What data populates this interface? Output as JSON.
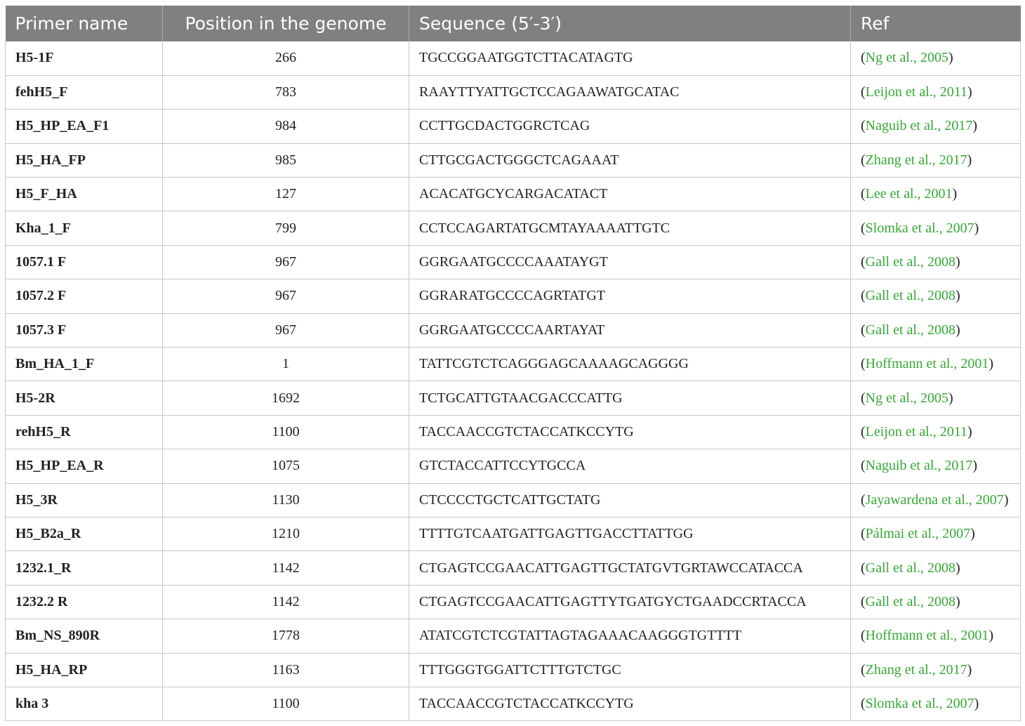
{
  "table": {
    "headers": {
      "primer_name": "Primer name",
      "position": "Position in the genome",
      "sequence": "Sequence (5′-3′)",
      "ref": "Ref"
    },
    "rows": [
      {
        "name": "H5-1F",
        "position": "266",
        "sequence": "TGCCGGAATGGTCTTACATAGTG",
        "ref": "Ng et al., 2005"
      },
      {
        "name": "fehH5_F",
        "position": "783",
        "sequence": "RAAYTTYATTGCTCCAGAAWATGCATAC",
        "ref": "Leijon et al., 2011"
      },
      {
        "name": "H5_HP_EA_F1",
        "position": "984",
        "sequence": "CCTTGCDACTGGRCTCAG",
        "ref": "Naguib et al., 2017"
      },
      {
        "name": "H5_HA_FP",
        "position": "985",
        "sequence": "CTTGCGACTGGGCTCAGAAAT",
        "ref": "Zhang et al., 2017"
      },
      {
        "name": "H5_F_HA",
        "position": "127",
        "sequence": "ACACATGCYCARGACATACT",
        "ref": "Lee et al., 2001"
      },
      {
        "name": "Kha_1_F",
        "position": "799",
        "sequence": "CCTCCAGARTATGCMTAYAAAATTGTC",
        "ref": "Slomka et al., 2007"
      },
      {
        "name": "1057.1 F",
        "position": "967",
        "sequence": "GGRGAATGCCCCAAATAYGT",
        "ref": "Gall et al., 2008"
      },
      {
        "name": "1057.2 F",
        "position": "967",
        "sequence": "GGRARATGCCCCAGRTATGT",
        "ref": "Gall et al., 2008"
      },
      {
        "name": "1057.3 F",
        "position": "967",
        "sequence": "GGRGAATGCCCCAARTAYAT",
        "ref": "Gall et al., 2008"
      },
      {
        "name": "Bm_HA_1_F",
        "position": "1",
        "sequence": "TATTCGTCTCAGGGAGCAAAAGCAGGGG",
        "ref": "Hoffmann et al., 2001"
      },
      {
        "name": "H5-2R",
        "position": "1692",
        "sequence": "TCTGCATTGTAACGACCCATTG",
        "ref": "Ng et al., 2005"
      },
      {
        "name": "rehH5_R",
        "position": "1100",
        "sequence": "TACCAACCGTCTACCATKCCYTG",
        "ref": "Leijon et al., 2011"
      },
      {
        "name": "H5_HP_EA_R",
        "position": "1075",
        "sequence": "GTCTACCATTCCYTGCCA",
        "ref": "Naguib et al., 2017"
      },
      {
        "name": "H5_3R",
        "position": "1130",
        "sequence": "CTCCCCTGCTCATTGCTATG",
        "ref": "Jayawardena et al., 2007"
      },
      {
        "name": "H5_B2a_R",
        "position": "1210",
        "sequence": "TTTTGTCAATGATTGAGTTGACCTTATTGG",
        "ref": "Pálmai et al., 2007"
      },
      {
        "name": "1232.1_R",
        "position": "1142",
        "sequence": "CTGAGTCCGAACATTGAGTTGCTATGVTGRTAWCCATACCA",
        "ref": "Gall et al., 2008"
      },
      {
        "name": "1232.2 R",
        "position": "1142",
        "sequence": "CTGAGTCCGAACATTGAGTTYTGATGYCTGAADCCRTACCA",
        "ref": "Gall et al., 2008"
      },
      {
        "name": "Bm_NS_890R",
        "position": "1778",
        "sequence": "ATATCGTCTCGTATTAGTAGAAACAAGGGTGTTTT",
        "ref": "Hoffmann et al., 2001"
      },
      {
        "name": "H5_HA_RP",
        "position": "1163",
        "sequence": "TTTGGGTGGATTCTTTGTCTGC",
        "ref": "Zhang et al., 2017"
      },
      {
        "name": "kha 3",
        "position": "1100",
        "sequence": "TACCAACCGTCTACCATKCCYTG",
        "ref": "Slomka et al., 2007"
      }
    ]
  },
  "colors": {
    "header_bg": "#808080",
    "header_text": "#ffffff",
    "link": "#35a835"
  }
}
